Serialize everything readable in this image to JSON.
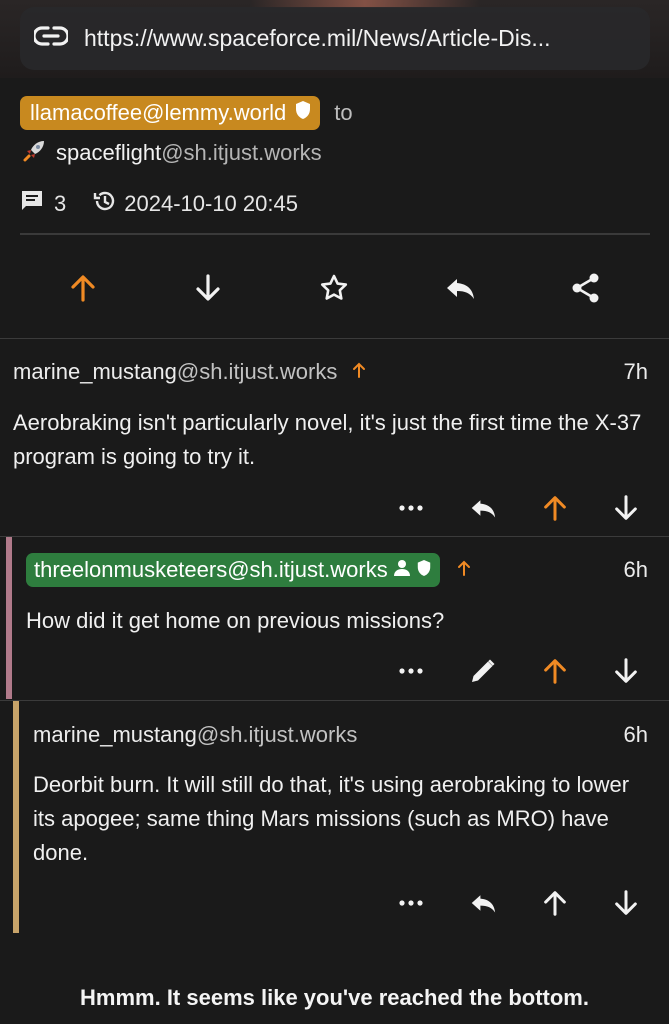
{
  "post": {
    "link_url": "https://www.spaceforce.mil/News/Article-Dis...",
    "creator": "llamacoffee@lemmy.world",
    "to_label": "to",
    "community_name": "spaceflight",
    "community_instance": "@sh.itjust.works",
    "comment_count": "3",
    "timestamp": "2024-10-10 20:45"
  },
  "comments": [
    {
      "user": "marine_mustang",
      "instance": "@sh.itjust.works",
      "upvoted": true,
      "age": "7h",
      "body": "Aerobraking isn't particularly novel, it's just the first time the X-37 program is going to try it."
    },
    {
      "user": "threelonmusketeers",
      "instance": "@sh.itjust.works",
      "upvoted": true,
      "age": "6h",
      "body": "How did it get home on previous missions?"
    },
    {
      "user": "marine_mustang",
      "instance": "@sh.itjust.works",
      "upvoted": false,
      "age": "6h",
      "body": "Deorbit burn. It will still do that, it's using aerobraking to lower its apogee; same thing Mars missions (such as MRO) have done."
    }
  ],
  "footer": {
    "end_message": "Hmmm. It seems like you've reached the bottom."
  },
  "colors": {
    "accent_orange": "#f08a24",
    "creator_badge": "#c8891f",
    "op_badge": "#2e7d3e",
    "thread_bar_pink": "#b07a8a",
    "thread_bar_tan": "#c8a46a"
  }
}
